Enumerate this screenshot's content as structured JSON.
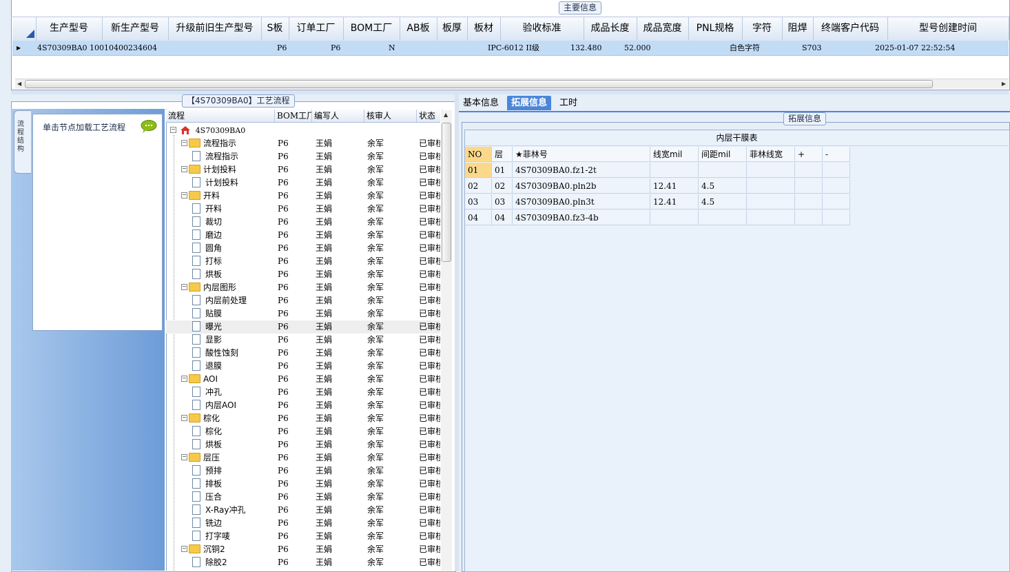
{
  "main_info": {
    "title": "主要信息",
    "columns": [
      "生产型号",
      "新生产型号",
      "升级前旧生产型号",
      "S板",
      "订单工厂",
      "BOM工厂",
      "AB板",
      "板厚",
      "板材",
      "验收标准",
      "成品长度",
      "成品宽度",
      "PNL规格",
      "字符",
      "阻焊",
      "终端客户代码",
      "型号创建时间"
    ],
    "row": [
      "4S70309BA0",
      "10010400234604",
      "",
      "",
      "P6",
      "P6",
      "N",
      "",
      "",
      "IPC-6012 II级",
      "132.480",
      "52.000",
      "",
      "白色字符",
      "",
      "S703",
      "2025-01-07 22:52:54"
    ]
  },
  "process": {
    "title": "【4S70309BA0】工艺流程",
    "side_tab": "流程结构",
    "hint": "单击节点加载工艺流程",
    "columns": [
      "流程",
      "BOM工厂",
      "编写人",
      "核审人",
      "状态"
    ],
    "root": "4S70309BA0",
    "rows": [
      {
        "name": "流程指示",
        "type": "folder",
        "bom": "P6",
        "writer": "王娟",
        "reviewer": "余军",
        "status": "已审核"
      },
      {
        "name": "流程指示",
        "type": "doc",
        "bom": "P6",
        "writer": "王娟",
        "reviewer": "余军",
        "status": "已审核"
      },
      {
        "name": "计划投料",
        "type": "folder",
        "bom": "P6",
        "writer": "王娟",
        "reviewer": "余军",
        "status": "已审核"
      },
      {
        "name": "计划投料",
        "type": "doc",
        "bom": "P6",
        "writer": "王娟",
        "reviewer": "余军",
        "status": "已审核"
      },
      {
        "name": "开料",
        "type": "folder",
        "bom": "P6",
        "writer": "王娟",
        "reviewer": "余军",
        "status": "已审核"
      },
      {
        "name": "开料",
        "type": "doc",
        "bom": "P6",
        "writer": "王娟",
        "reviewer": "余军",
        "status": "已审核"
      },
      {
        "name": "裁切",
        "type": "doc",
        "bom": "P6",
        "writer": "王娟",
        "reviewer": "余军",
        "status": "已审核"
      },
      {
        "name": "磨边",
        "type": "doc",
        "bom": "P6",
        "writer": "王娟",
        "reviewer": "余军",
        "status": "已审核"
      },
      {
        "name": "圆角",
        "type": "doc",
        "bom": "P6",
        "writer": "王娟",
        "reviewer": "余军",
        "status": "已审核"
      },
      {
        "name": "打标",
        "type": "doc",
        "bom": "P6",
        "writer": "王娟",
        "reviewer": "余军",
        "status": "已审核"
      },
      {
        "name": "烘板",
        "type": "doc",
        "bom": "P6",
        "writer": "王娟",
        "reviewer": "余军",
        "status": "已审核"
      },
      {
        "name": "内层图形",
        "type": "folder",
        "bom": "P6",
        "writer": "王娟",
        "reviewer": "余军",
        "status": "已审核"
      },
      {
        "name": "内层前处理",
        "type": "doc",
        "bom": "P6",
        "writer": "王娟",
        "reviewer": "余军",
        "status": "已审核"
      },
      {
        "name": "贴膜",
        "type": "doc",
        "bom": "P6",
        "writer": "王娟",
        "reviewer": "余军",
        "status": "已审核"
      },
      {
        "name": "曝光",
        "type": "doc",
        "bom": "P6",
        "writer": "王娟",
        "reviewer": "余军",
        "status": "已审核"
      },
      {
        "name": "显影",
        "type": "doc",
        "bom": "P6",
        "writer": "王娟",
        "reviewer": "余军",
        "status": "已审核"
      },
      {
        "name": "酸性蚀刻",
        "type": "doc",
        "bom": "P6",
        "writer": "王娟",
        "reviewer": "余军",
        "status": "已审核"
      },
      {
        "name": "退膜",
        "type": "doc",
        "bom": "P6",
        "writer": "王娟",
        "reviewer": "余军",
        "status": "已审核"
      },
      {
        "name": "AOI",
        "type": "folder",
        "bom": "P6",
        "writer": "王娟",
        "reviewer": "余军",
        "status": "已审核"
      },
      {
        "name": "冲孔",
        "type": "doc",
        "bom": "P6",
        "writer": "王娟",
        "reviewer": "余军",
        "status": "已审核"
      },
      {
        "name": "内层AOI",
        "type": "doc",
        "bom": "P6",
        "writer": "王娟",
        "reviewer": "余军",
        "status": "已审核"
      },
      {
        "name": "棕化",
        "type": "folder",
        "bom": "P6",
        "writer": "王娟",
        "reviewer": "余军",
        "status": "已审核"
      },
      {
        "name": "棕化",
        "type": "doc",
        "bom": "P6",
        "writer": "王娟",
        "reviewer": "余军",
        "status": "已审核"
      },
      {
        "name": "烘板",
        "type": "doc",
        "bom": "P6",
        "writer": "王娟",
        "reviewer": "余军",
        "status": "已审核"
      },
      {
        "name": "层压",
        "type": "folder",
        "bom": "P6",
        "writer": "王娟",
        "reviewer": "余军",
        "status": "已审核"
      },
      {
        "name": "预排",
        "type": "doc",
        "bom": "P6",
        "writer": "王娟",
        "reviewer": "余军",
        "status": "已审核"
      },
      {
        "name": "排板",
        "type": "doc",
        "bom": "P6",
        "writer": "王娟",
        "reviewer": "余军",
        "status": "已审核"
      },
      {
        "name": "压合",
        "type": "doc",
        "bom": "P6",
        "writer": "王娟",
        "reviewer": "余军",
        "status": "已审核"
      },
      {
        "name": "X-Ray冲孔",
        "type": "doc",
        "bom": "P6",
        "writer": "王娟",
        "reviewer": "余军",
        "status": "已审核"
      },
      {
        "name": "铣边",
        "type": "doc",
        "bom": "P6",
        "writer": "王娟",
        "reviewer": "余军",
        "status": "已审核"
      },
      {
        "name": "打字唛",
        "type": "doc",
        "bom": "P6",
        "writer": "王娟",
        "reviewer": "余军",
        "status": "已审核"
      },
      {
        "name": "沉铜2",
        "type": "folder",
        "bom": "P6",
        "writer": "王娟",
        "reviewer": "余军",
        "status": "已审核"
      },
      {
        "name": "除胶2",
        "type": "doc",
        "bom": "P6",
        "writer": "王娟",
        "reviewer": "余军",
        "status": "已审核"
      }
    ]
  },
  "tabs": [
    "基本信息",
    "拓展信息",
    "工时"
  ],
  "extended": {
    "title": "拓展信息",
    "table_title": "内层干膜表",
    "columns": [
      "NO",
      "层",
      "★菲林号",
      "线宽mil",
      "间距mil",
      "菲林线宽",
      "+",
      "-"
    ],
    "rows": [
      [
        "01",
        "01",
        "4S70309BA0.fz1-2t",
        "",
        "",
        "",
        "",
        ""
      ],
      [
        "02",
        "02",
        "4S70309BA0.pln2b",
        "12.41",
        "4.5",
        "",
        "",
        ""
      ],
      [
        "03",
        "03",
        "4S70309BA0.pln3t",
        "12.41",
        "4.5",
        "",
        "",
        ""
      ],
      [
        "04",
        "04",
        "4S70309BA0.fz3-4b",
        "",
        "",
        "",
        "",
        ""
      ]
    ]
  },
  "colors": {
    "accent": "#4a86d8",
    "selected_row": "#c3dcf6",
    "highlight": "#fcd98a"
  }
}
